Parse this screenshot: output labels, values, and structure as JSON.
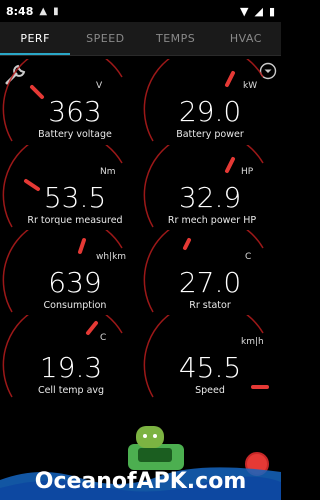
{
  "status": {
    "time": "8:48"
  },
  "tabs": [
    {
      "label": "PERF"
    },
    {
      "label": "SPEED"
    },
    {
      "label": "TEMPS"
    },
    {
      "label": "HVAC"
    }
  ],
  "gauges": [
    {
      "value": "363",
      "unit": "V",
      "label": "Battery voltage"
    },
    {
      "value": "29.0",
      "unit": "kW",
      "label": "Battery power"
    },
    {
      "value": "53.5",
      "unit": "Nm",
      "label": "Rr torque measured"
    },
    {
      "value": "32.9",
      "unit": "HP",
      "label": "Rr mech power HP"
    },
    {
      "value": "639",
      "unit": "wh|km",
      "label": "Consumption"
    },
    {
      "value": "27.0",
      "unit": "C",
      "label": "Rr stator"
    },
    {
      "value": "19.3",
      "unit": "C",
      "label": "Cell temp avg"
    },
    {
      "value": "45.5",
      "unit": "km|h",
      "label": "Speed"
    }
  ],
  "watermark": {
    "text": "OceanofAPK.com"
  },
  "colors": {
    "accent": "#2aa7c7",
    "gauge_arc": "#d32f2f",
    "gauge_needle": "#e53935"
  }
}
